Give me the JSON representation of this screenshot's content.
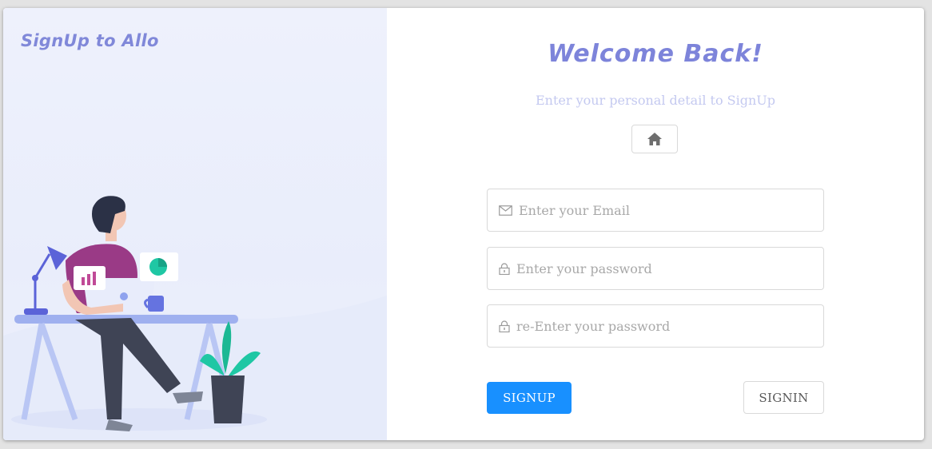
{
  "brand": {
    "title": "SignUp to Allo"
  },
  "form": {
    "title": "Welcome Back!",
    "subtitle": "Enter your personal detail to SignUp",
    "home_icon": "home-icon",
    "email": {
      "placeholder": "Enter your Email",
      "value": "",
      "icon": "mail-icon"
    },
    "password": {
      "placeholder": "Enter your password",
      "value": "",
      "icon": "lock-icon"
    },
    "confirm_password": {
      "placeholder": "re-Enter your password",
      "value": "",
      "icon": "lock-icon"
    },
    "signup_label": "SIGNUP",
    "signin_label": "SIGNIN"
  },
  "colors": {
    "accent": "#1890ff",
    "title": "#7d84da",
    "subtitle": "#c4c9f0",
    "panel_bg": "#eef1fc"
  }
}
